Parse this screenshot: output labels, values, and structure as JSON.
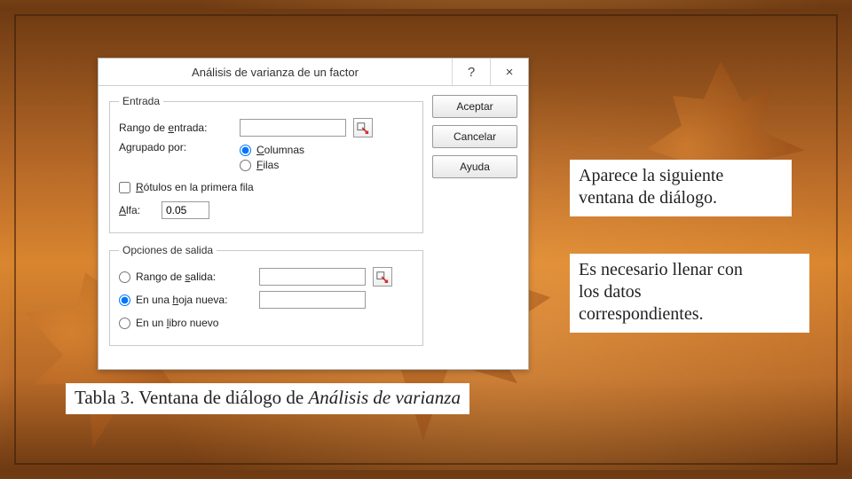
{
  "dialog": {
    "title": "Análisis de varianza de un factor",
    "help_symbol": "?",
    "close_symbol": "×",
    "buttons": {
      "accept": "Aceptar",
      "cancel": "Cancelar",
      "help": "Ayuda"
    },
    "entrada": {
      "legend": "Entrada",
      "range_label_pre": "Rango de ",
      "range_label_u": "e",
      "range_label_post": "ntrada:",
      "range_value": "",
      "group_label": "Agrupado por:",
      "group_cols_u": "C",
      "group_cols_post": "olumnas",
      "group_rows_u": "F",
      "group_rows_post": "ilas",
      "group_selected": "columnas",
      "labels_first_row_u": "R",
      "labels_first_row_post": "ótulos en la primera fila",
      "labels_first_row_checked": false,
      "alfa_u": "A",
      "alfa_post": "lfa:",
      "alfa_value": "0.05"
    },
    "salida": {
      "legend": "Opciones de salida",
      "out_range_pre": "Rango de ",
      "out_range_u": "s",
      "out_range_post": "alida:",
      "out_range_value": "",
      "new_sheet_pre": "En una ",
      "new_sheet_u": "h",
      "new_sheet_post": "oja nueva:",
      "new_sheet_value": "",
      "new_book_pre": "En un ",
      "new_book_u": "l",
      "new_book_post": "ibro nuevo",
      "selected": "hoja"
    }
  },
  "notes": {
    "n1a": "Aparece la siguiente",
    "n1b": "ventana de diálogo.",
    "n2a": "Es necesario llenar con",
    "n2b": "los datos",
    "n2c": "correspondientes."
  },
  "caption": {
    "pre": "Tabla 3. Ventana de diálogo de ",
    "em": "Análisis de varianza"
  }
}
